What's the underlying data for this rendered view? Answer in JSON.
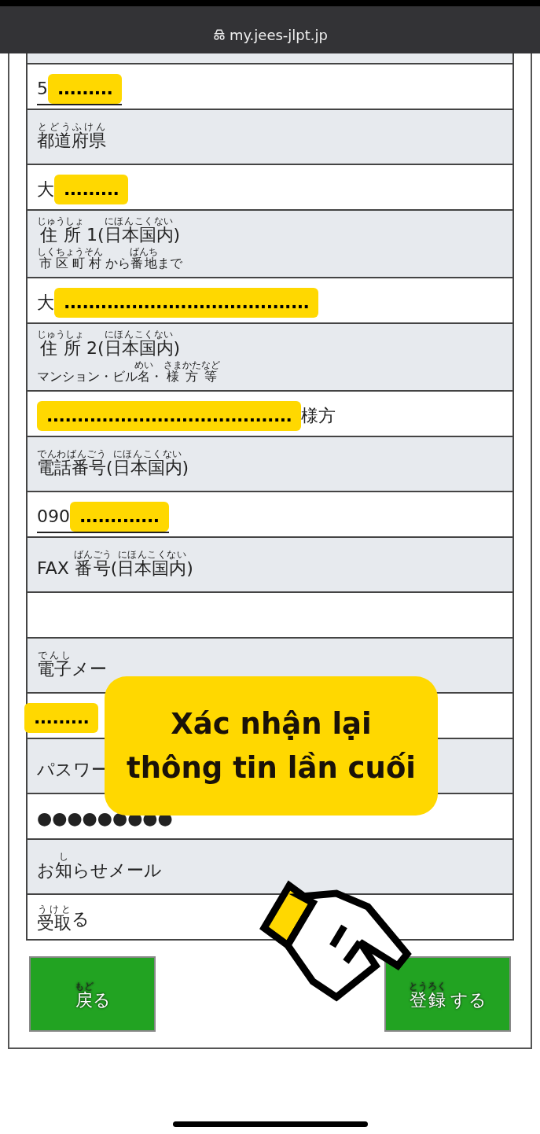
{
  "browser": {
    "url": "my.jees-jlpt.jp"
  },
  "rows": [
    {
      "kind": "cut"
    },
    {
      "kind": "value",
      "underline": true,
      "segments": [
        {
          "text": "5"
        },
        {
          "text": ".........",
          "redacted": true
        }
      ]
    },
    {
      "kind": "label",
      "lines": [
        {
          "kind": "main",
          "segments": [
            {
              "text": "都道府県",
              "ruby": "とどうふけん"
            }
          ]
        }
      ]
    },
    {
      "kind": "value",
      "segments": [
        {
          "text": "大"
        },
        {
          "text": ".........",
          "redacted": true
        }
      ]
    },
    {
      "kind": "label",
      "lines": [
        {
          "kind": "main",
          "segments": [
            {
              "text": "住所",
              "ruby": "じゅうしょ"
            },
            {
              "text": " 1("
            },
            {
              "text": "日本国内",
              "ruby": "にほんこくない"
            },
            {
              "text": ")"
            }
          ]
        },
        {
          "kind": "note",
          "segments": [
            {
              "text": "市区町村",
              "ruby": "しくちょうそん"
            },
            {
              "text": " から"
            },
            {
              "text": "番地",
              "ruby": "ばんち"
            },
            {
              "text": "まで"
            }
          ]
        }
      ]
    },
    {
      "kind": "value",
      "segments": [
        {
          "text": "大"
        },
        {
          "text": "........................................",
          "redacted": true
        }
      ]
    },
    {
      "kind": "label",
      "lines": [
        {
          "kind": "main",
          "segments": [
            {
              "text": "住所",
              "ruby": "じゅうしょ"
            },
            {
              "text": " 2("
            },
            {
              "text": "日本国内",
              "ruby": "にほんこくない"
            },
            {
              "text": ")"
            }
          ]
        },
        {
          "kind": "note",
          "segments": [
            {
              "text": "マンション・ビル"
            },
            {
              "text": "名",
              "ruby": "めい"
            },
            {
              "text": "・ "
            },
            {
              "text": "様方等",
              "ruby": "さまかたなど"
            }
          ]
        }
      ]
    },
    {
      "kind": "value",
      "segments": [
        {
          "text": "........................................",
          "redacted": true
        },
        {
          "text": "様方"
        }
      ]
    },
    {
      "kind": "label",
      "lines": [
        {
          "kind": "main",
          "segments": [
            {
              "text": "電話番号",
              "ruby": "でんわばんごう"
            },
            {
              "text": "("
            },
            {
              "text": "日本国内",
              "ruby": "にほんこくない"
            },
            {
              "text": ")"
            }
          ]
        }
      ]
    },
    {
      "kind": "value",
      "underline": true,
      "segments": [
        {
          "text": "090"
        },
        {
          "text": ".............",
          "redacted": true
        }
      ]
    },
    {
      "kind": "label",
      "lines": [
        {
          "kind": "main",
          "segments": [
            {
              "text": "FAX "
            },
            {
              "text": "番号",
              "ruby": "ばんごう"
            },
            {
              "text": "("
            },
            {
              "text": "日本国内",
              "ruby": "にほんこくない"
            },
            {
              "text": ")"
            }
          ]
        }
      ]
    },
    {
      "kind": "value"
    },
    {
      "kind": "label",
      "lines": [
        {
          "kind": "main",
          "segments": [
            {
              "text": "電子",
              "ruby": "でんし"
            },
            {
              "text": "メー"
            }
          ]
        }
      ]
    },
    {
      "kind": "value",
      "segments": [
        {
          "text": ".........",
          "redacted": true
        }
      ]
    },
    {
      "kind": "label",
      "lines": [
        {
          "kind": "main",
          "segments": [
            {
              "text": "パスワー"
            }
          ]
        }
      ]
    },
    {
      "kind": "value",
      "segments": [
        {
          "text": "●●●●●●●●●"
        }
      ]
    },
    {
      "kind": "label",
      "lines": [
        {
          "kind": "main",
          "segments": [
            {
              "text": "お"
            },
            {
              "text": "知",
              "ruby": "し"
            },
            {
              "text": "らせメール"
            }
          ]
        }
      ]
    },
    {
      "kind": "value",
      "segments": [
        {
          "text": "受取",
          "ruby": "うけと"
        },
        {
          "text": "る"
        }
      ]
    }
  ],
  "buttons": [
    {
      "segments": [
        {
          "text": "戻",
          "ruby": "もど"
        },
        {
          "text": "る"
        }
      ]
    },
    {
      "segments": [
        {
          "text": "登録",
          "ruby": "とうろく"
        },
        {
          "text": " する"
        }
      ]
    }
  ],
  "caption": {
    "lines": [
      "Xác nhận lại",
      "thông tin lần cuối"
    ]
  }
}
